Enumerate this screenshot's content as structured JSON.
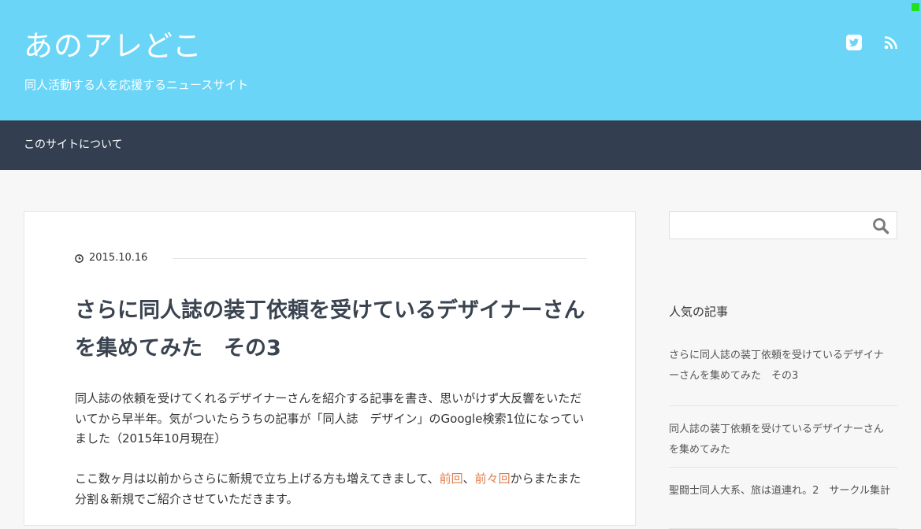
{
  "header": {
    "site_title": "あのアレどこ",
    "site_description": "同人活動する人を応援するニュースサイト",
    "social_icons": [
      "twitter-icon",
      "rss-icon"
    ],
    "colors": {
      "header_bg": "#6bd5f7",
      "nav_bg": "#333f50",
      "link": "#e27d4a"
    }
  },
  "nav": {
    "items": [
      {
        "label": "このサイトについて"
      }
    ]
  },
  "article": {
    "date": "2015.10.16",
    "title": "さらに同人誌の装丁依頼を受けているデザイナーさんを集めてみた　その3",
    "paragraph1": "同人誌の依頼を受けてくれるデザイナーさんを紹介する記事を書き、思いがけず大反響をいただいてから早半年。気がついたらうちの記事が「同人誌　デザイン」のGoogle検索1位になっていました（2015年10月現在）",
    "paragraph2": {
      "before": "ここ数ヶ月は以前からさらに新規で立ち上げる方も増えてきまして、",
      "link1": "前回",
      "sep": "、",
      "link2": "前々回",
      "after": "からまたまた分割＆新規でご紹介させていただきます。"
    }
  },
  "sidebar": {
    "search": {
      "placeholder": "",
      "value": ""
    },
    "popular": {
      "title": "人気の記事",
      "items": [
        {
          "label": "さらに同人誌の装丁依頼を受けているデザイナーさんを集めてみた　その3"
        },
        {
          "label": "同人誌の装丁依頼を受けているデザイナーさんを集めてみた"
        },
        {
          "label": "聖闘士同人大系、旅は道連れ。2　サークル集計"
        }
      ]
    }
  }
}
